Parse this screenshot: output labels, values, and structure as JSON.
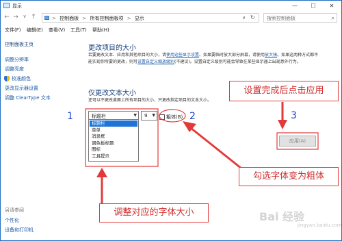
{
  "window": {
    "title": "显示",
    "min_label": "—",
    "max_label": "☐",
    "close_label": "✕"
  },
  "address": {
    "back": "←",
    "forward": "→",
    "up": "↑",
    "crumbs": [
      "控制面板",
      "所有控制面板项",
      "显示"
    ],
    "crumb_sep": ">",
    "dropdown": "∨",
    "refresh": "↻",
    "search_placeholder": "搜索控制面板"
  },
  "menu": [
    "文件(F)",
    "编辑(E)",
    "查看(V)",
    "工具(T)",
    "帮助(H)"
  ],
  "sidebar": {
    "home": "控制面板主页",
    "items": [
      "调整分辨率",
      "调整亮度",
      "校准颜色",
      "更改显示器设置",
      "调整 ClearType 文本"
    ],
    "see_also_label": "另请参阅",
    "see_also": [
      "个性化",
      "设备和打印机"
    ]
  },
  "main": {
    "heading1": "更改项目的大小",
    "para1_a": "若要更改文本、应用和其他项目的大小，请",
    "para1_link1": "使用这些显示设置",
    "para1_b": "。如果要临时放大部分屏幕，请使用",
    "para1_link2": "放大镜",
    "para1_c": "。如果这两种方式都不能实现你所要的更改，则可",
    "para1_link3": "设置自定义缩放级别",
    "para1_d": "(不建议)。设置自定义级别可能会导致在某些显示器上出现意外行为。",
    "heading2": "仅更改文本大小",
    "para2": "还可以不更改桌面上所有项目的大小，只更改指定项目的文本大小。",
    "item_select_value": "标题栏",
    "size_select_value": "9",
    "dropdown_items": [
      "标题栏",
      "菜单",
      "消息框",
      "调色板标题",
      "图标",
      "工具提示"
    ],
    "bold_label": "粗体(B)",
    "apply_label": "应用(A)"
  },
  "annotations": {
    "num1": "1",
    "num2": "2",
    "num3": "3",
    "callout_apply": "设置完成后点击应用",
    "callout_bold": "勾选字体变为粗体",
    "callout_size": "调整对应的字体大小"
  },
  "watermark": {
    "main": "Bai  经验",
    "sub": "jingyan.baidu.com"
  },
  "colors": {
    "annotation_red": "#e23a3a",
    "annotation_blue": "#2040c8",
    "link_blue": "#1a5aa8",
    "heading_blue": "#1a3f7a",
    "selection_blue": "#1f74d6"
  }
}
